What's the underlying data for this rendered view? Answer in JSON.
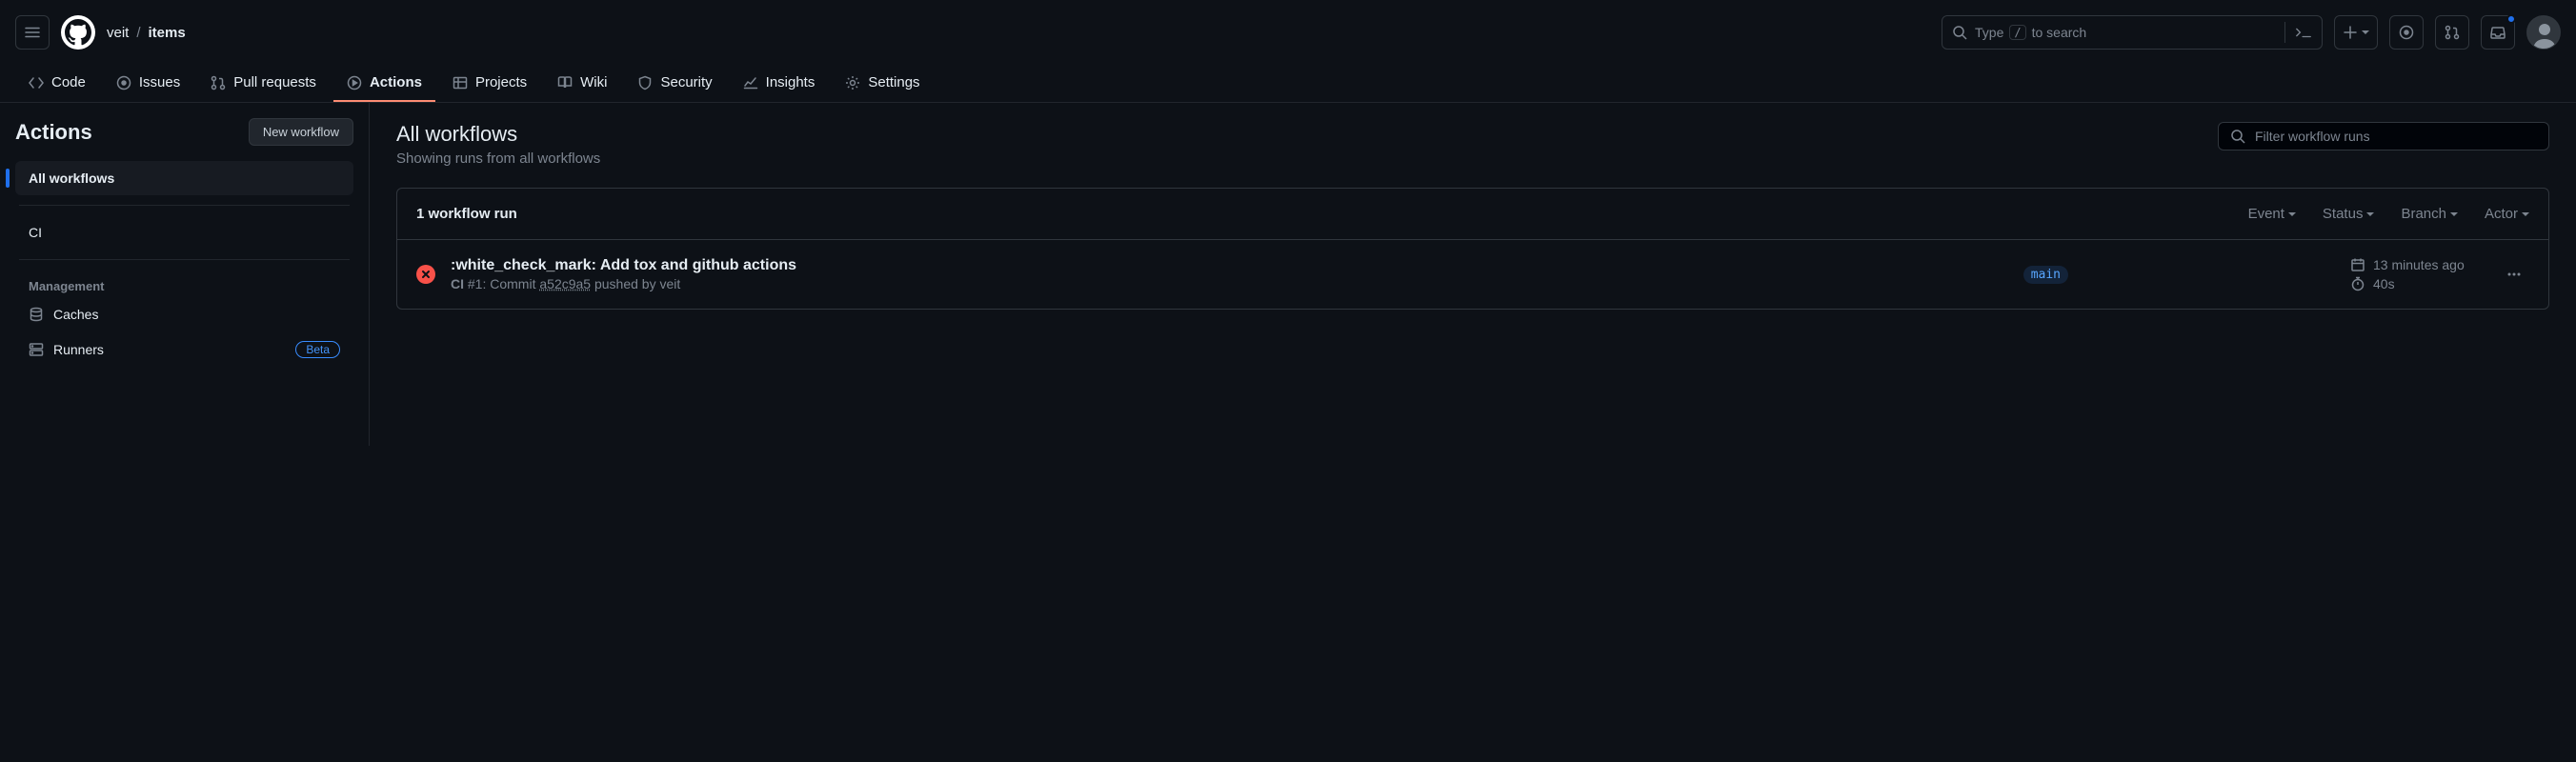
{
  "breadcrumb": {
    "owner": "veit",
    "sep": "/",
    "repo": "items"
  },
  "search": {
    "prefix": "Type",
    "key": "/",
    "suffix": "to search"
  },
  "nav": {
    "code": "Code",
    "issues": "Issues",
    "pulls": "Pull requests",
    "actions": "Actions",
    "projects": "Projects",
    "wiki": "Wiki",
    "security": "Security",
    "insights": "Insights",
    "settings": "Settings"
  },
  "sidebar": {
    "title": "Actions",
    "new_btn": "New workflow",
    "all": "All workflows",
    "ci": "CI",
    "mgmt_heading": "Management",
    "caches": "Caches",
    "runners": "Runners",
    "beta": "Beta"
  },
  "main": {
    "title": "All workflows",
    "subtitle": "Showing runs from all workflows",
    "filter_placeholder": "Filter workflow runs"
  },
  "runs": {
    "count_label": "1 workflow run",
    "filters": {
      "event": "Event",
      "status": "Status",
      "branch": "Branch",
      "actor": "Actor"
    },
    "item": {
      "title": ":white_check_mark: Add tox and github actions",
      "workflow": "CI",
      "runnum": " #1: ",
      "commit_prefix": "Commit ",
      "commit_sha": "a52c9a5",
      "pushed_by": " pushed by veit",
      "branch": "main",
      "time": "13 minutes ago",
      "duration": "40s"
    }
  }
}
